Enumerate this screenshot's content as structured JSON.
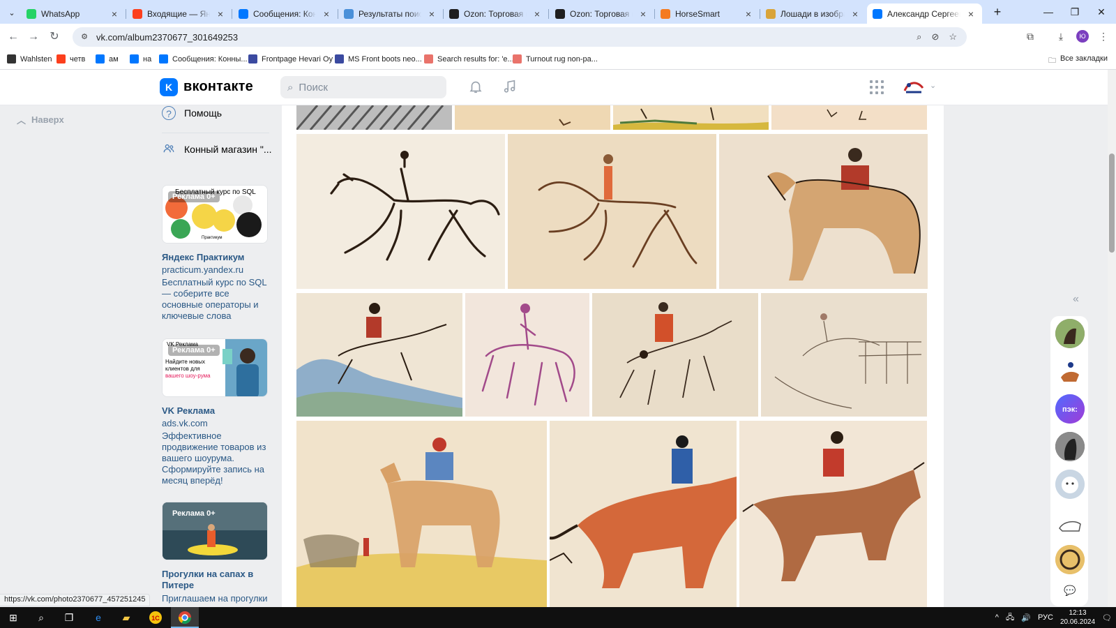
{
  "browser": {
    "tabs": [
      {
        "title": "WhatsApp",
        "favicon_color": "#25d366",
        "active": false
      },
      {
        "title": "Входящие — Яндекс",
        "favicon_color": "#fc3f1d",
        "active": false
      },
      {
        "title": "Сообщения: Конный",
        "favicon_color": "#0077ff",
        "active": false
      },
      {
        "title": "Результаты поиска",
        "favicon_color": "#4a90d9",
        "active": false
      },
      {
        "title": "Ozon: Торговая пло",
        "favicon_color": "#1f1f1f",
        "active": false
      },
      {
        "title": "Ozon: Торговая пло",
        "favicon_color": "#1f1f1f",
        "active": false
      },
      {
        "title": "HorseSmart",
        "favicon_color": "#f47b20",
        "active": false
      },
      {
        "title": "Лошади в изобрази",
        "favicon_color": "#d9a43a",
        "active": false
      },
      {
        "title": "Александр Сергеев",
        "favicon_color": "#0077ff",
        "active": true
      }
    ],
    "url": "vk.com/album2370677_301649253",
    "bookmarks": [
      {
        "label": "Wahlsten",
        "color": "#333333"
      },
      {
        "label": "четв",
        "color": "#fc3f1d"
      },
      {
        "label": "ам",
        "color": "#0077ff"
      },
      {
        "label": "на",
        "color": "#0077ff"
      },
      {
        "label": "Сообщения: Конны...",
        "color": "#0077ff"
      },
      {
        "label": "Frontpage Hevari Oy",
        "color": "#3b4aa0"
      },
      {
        "label": "MS Front boots neo...",
        "color": "#3b4aa0"
      },
      {
        "label": "Search results for: 'e...",
        "color": "#e9736b"
      },
      {
        "label": "Turnout rug non-pa...",
        "color": "#e9736b"
      }
    ],
    "all_bookmarks": "Все закладки",
    "status_url": "https://vk.com/photo2370677_457251245"
  },
  "vk": {
    "brand": "вконтакте",
    "logo_letter": "K",
    "search_placeholder": "Поиск",
    "up_label": "Наверх",
    "side_items": [
      {
        "label": "Помощь",
        "icon": "help-icon"
      },
      {
        "label": "Конный магазин \"...",
        "icon": "group-icon"
      }
    ],
    "ads": [
      {
        "badge": "Реклама 0+",
        "image_caption": "Бесплатный курс по SQL",
        "image_subcaption": "Практикум",
        "title": "Яндекс Практикум",
        "domain": "practicum.yandex.ru",
        "text": "Бесплатный курс по SQL — соберите все основные операторы и ключевые слова"
      },
      {
        "badge": "Реклама 0+",
        "image_caption": "Найдите новых клиентов для",
        "image_highlight": "вашего шоу-рума",
        "image_brand": "VK Реклама",
        "title": "VK Реклама",
        "domain": "ads.vk.com",
        "text": "Эффективное продвижение товаров из вашего шоурума. Сформируйте запись на месяц вперёд!"
      },
      {
        "badge": "Реклама 0+",
        "title": "Прогулки на сапах в Питере",
        "text": "Приглашаем на прогулки"
      }
    ]
  },
  "taskbar": {
    "language": "РУС",
    "time": "12:13",
    "date": "20.06.2024"
  }
}
